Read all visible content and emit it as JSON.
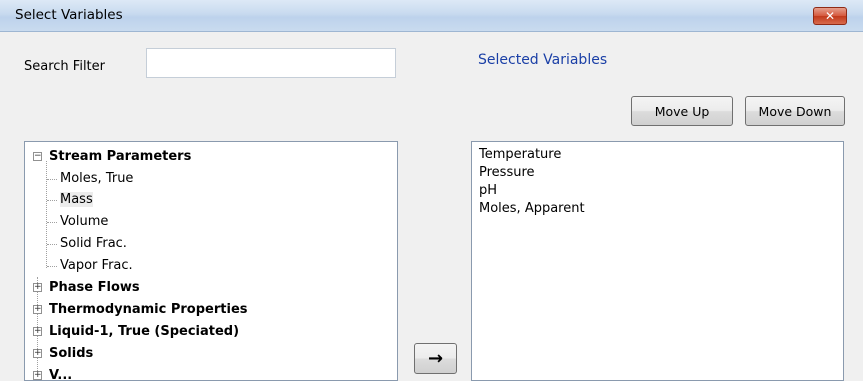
{
  "window": {
    "title": "Select Variables",
    "close_glyph": "✕"
  },
  "search": {
    "label": "Search Filter",
    "value": "",
    "placeholder": ""
  },
  "selected_panel": {
    "heading": "Selected Variables",
    "move_up_label": "Move Up",
    "move_down_label": "Move Down",
    "items": [
      "Temperature",
      "Pressure",
      "pH",
      "Moles, Apparent"
    ]
  },
  "tree": {
    "stream_parameters": {
      "label": "Stream Parameters",
      "expander": "−",
      "children": [
        "Moles, True",
        "Mass",
        "Volume",
        "Solid Frac.",
        "Vapor Frac."
      ],
      "selected_child": "Mass"
    },
    "groups": [
      {
        "label": "Phase Flows",
        "expander": "+"
      },
      {
        "label": "Thermodynamic Properties",
        "expander": "+"
      },
      {
        "label": "Liquid-1, True (Speciated)",
        "expander": "+"
      },
      {
        "label": "Solids",
        "expander": "+"
      },
      {
        "label": "V...",
        "expander": "+"
      }
    ]
  },
  "add_button": {
    "glyph": "→",
    "icon": "right-arrow-icon"
  }
}
